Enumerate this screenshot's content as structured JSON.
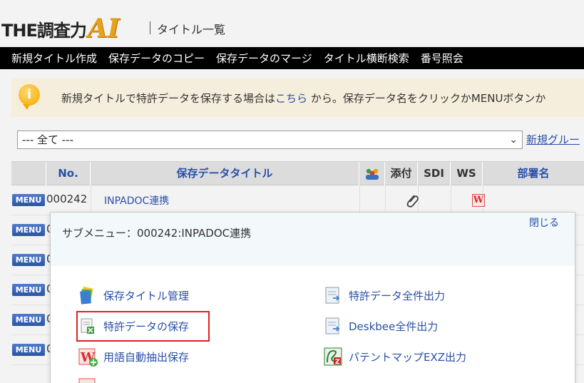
{
  "header": {
    "logo_the": "THE調査力",
    "logo_ai": "AI",
    "title": "タイトル一覧"
  },
  "nav": {
    "items": [
      "新規タイトル作成",
      "保存データのコピー",
      "保存データのマージ",
      "タイトル横断検索",
      "番号照会"
    ]
  },
  "notice": {
    "icon": "i",
    "text_before": "新規タイトルで特許データを保存する場合は",
    "link": "こちら",
    "text_after": "から。保存データ名をクリックかMENUボタンか"
  },
  "group": {
    "selected": "--- 全て ---",
    "new_group_link": "新規グルー"
  },
  "table": {
    "headers": [
      "No.",
      "保存データタイトル",
      "添付",
      "SDI",
      "WS",
      "部署名"
    ],
    "menu_label": "MENU",
    "rows": [
      {
        "no": "000242",
        "title": "INPADOC連携"
      },
      {
        "no": "0",
        "title": ""
      },
      {
        "no": "0",
        "title": ""
      },
      {
        "no": "0",
        "title": ""
      },
      {
        "no": "0",
        "title": ""
      },
      {
        "no": "0",
        "title": ""
      }
    ],
    "ws_icon": "W"
  },
  "submenu": {
    "title": "サブメニュー：000242:INPADOC連携",
    "close": "閉じる",
    "left_items": [
      "保存タイトル管理",
      "特許データの保存",
      "用語自動抽出保存"
    ],
    "right_items": [
      "特許データ全件出力",
      "Deskbee全件出力",
      "パテントマップEXZ出力"
    ]
  },
  "colors": {
    "link": "#2a4fa8",
    "navbar": "#000000",
    "highlight": "#e02020",
    "accent": "#e8a21a"
  }
}
